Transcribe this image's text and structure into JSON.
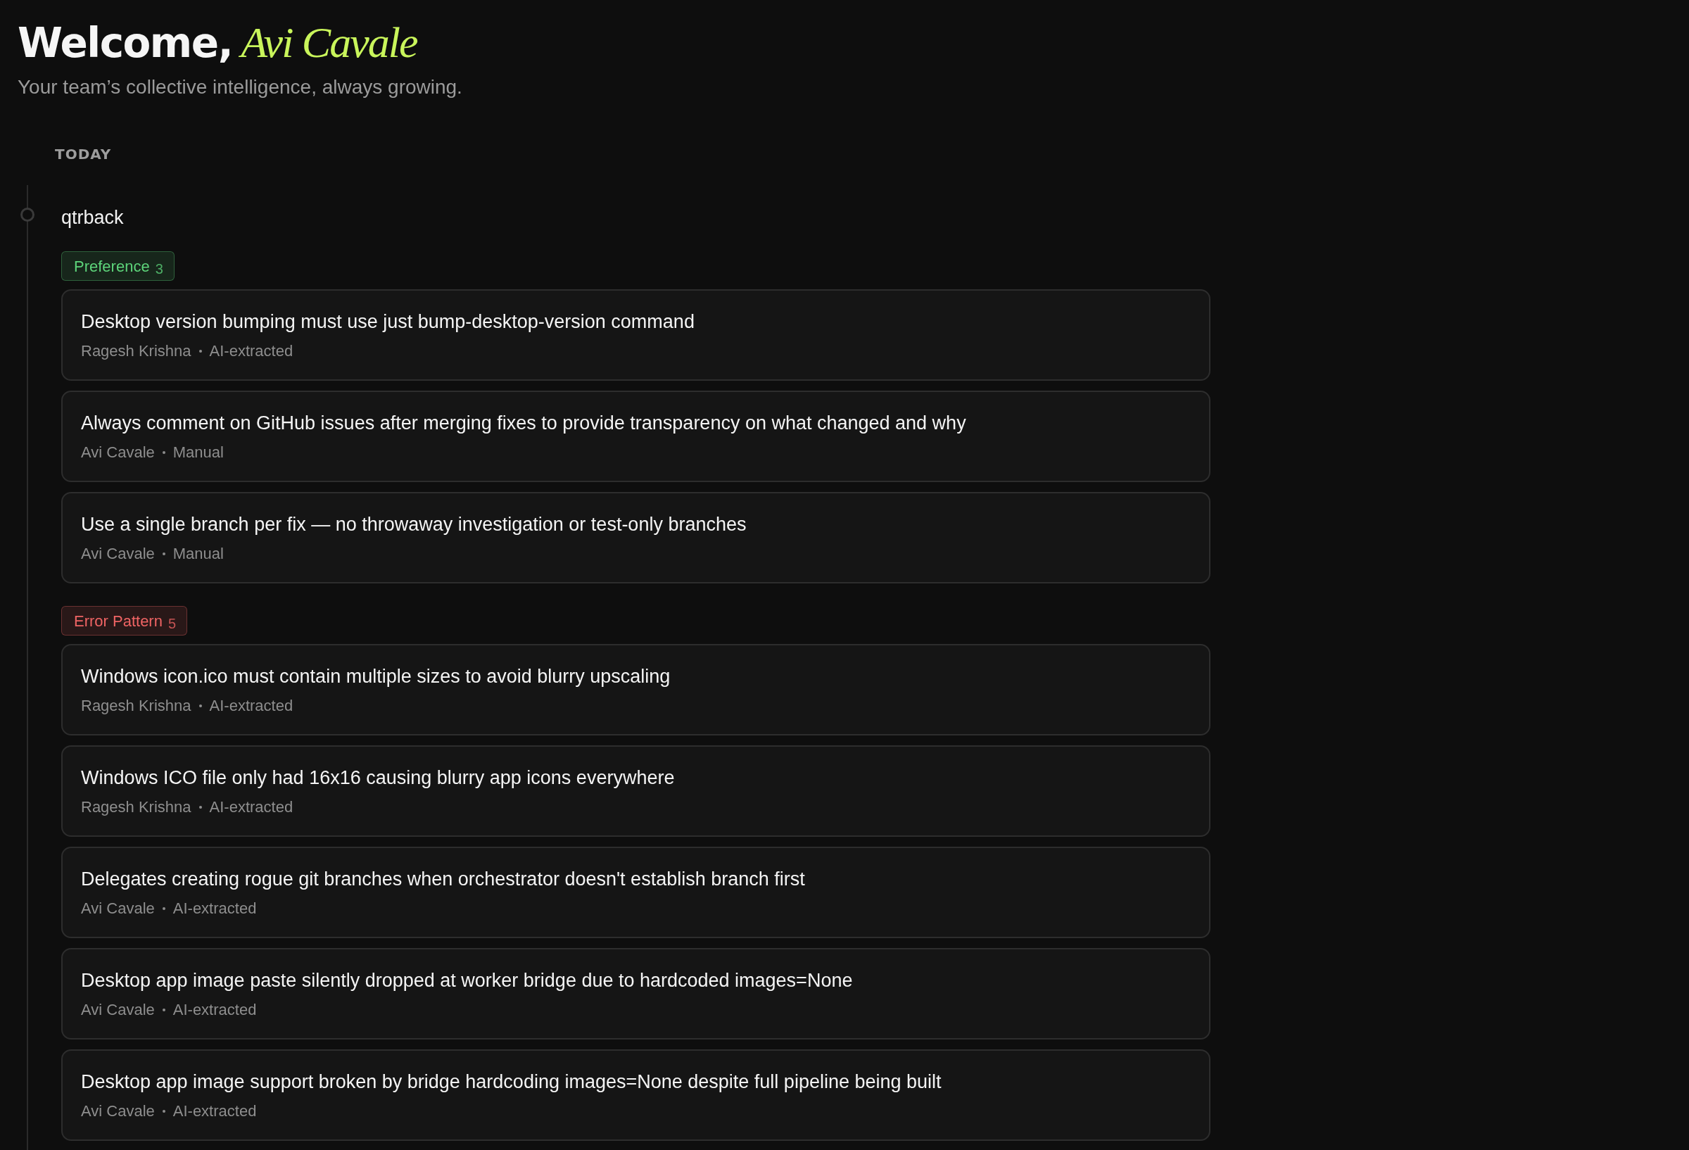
{
  "header": {
    "greeting": "Welcome,",
    "name": "Avi Cavale",
    "subtitle": "Your team’s collective intelligence, always growing."
  },
  "timeline": [
    {
      "date_label": "TODAY",
      "entries": [
        {
          "project": "qtrback",
          "groups": [
            {
              "category": "Preference",
              "count": "3",
              "color": "#5dd47a",
              "items": [
                {
                  "title": "Desktop version bumping must use just bump-desktop-version command",
                  "author": "Ragesh Krishna",
                  "source": "AI-extracted"
                },
                {
                  "title": "Always comment on GitHub issues after merging fixes to provide transparency on what changed and why",
                  "author": "Avi Cavale",
                  "source": "Manual"
                },
                {
                  "title": "Use a single branch per fix — no throwaway investigation or test-only branches",
                  "author": "Avi Cavale",
                  "source": "Manual"
                }
              ]
            },
            {
              "category": "Error Pattern",
              "count": "5",
              "color": "#ef6464",
              "items": [
                {
                  "title": "Windows icon.ico must contain multiple sizes to avoid blurry upscaling",
                  "author": "Ragesh Krishna",
                  "source": "AI-extracted"
                },
                {
                  "title": "Windows ICO file only had 16x16 causing blurry app icons everywhere",
                  "author": "Ragesh Krishna",
                  "source": "AI-extracted"
                },
                {
                  "title": "Delegates creating rogue git branches when orchestrator doesn't establish branch first",
                  "author": "Avi Cavale",
                  "source": "AI-extracted"
                },
                {
                  "title": "Desktop app image paste silently dropped at worker bridge due to hardcoded images=None",
                  "author": "Avi Cavale",
                  "source": "AI-extracted"
                },
                {
                  "title": "Desktop app image support broken by bridge hardcoding images=None despite full pipeline being built",
                  "author": "Avi Cavale",
                  "source": "AI-extracted"
                }
              ]
            }
          ]
        }
      ]
    }
  ]
}
